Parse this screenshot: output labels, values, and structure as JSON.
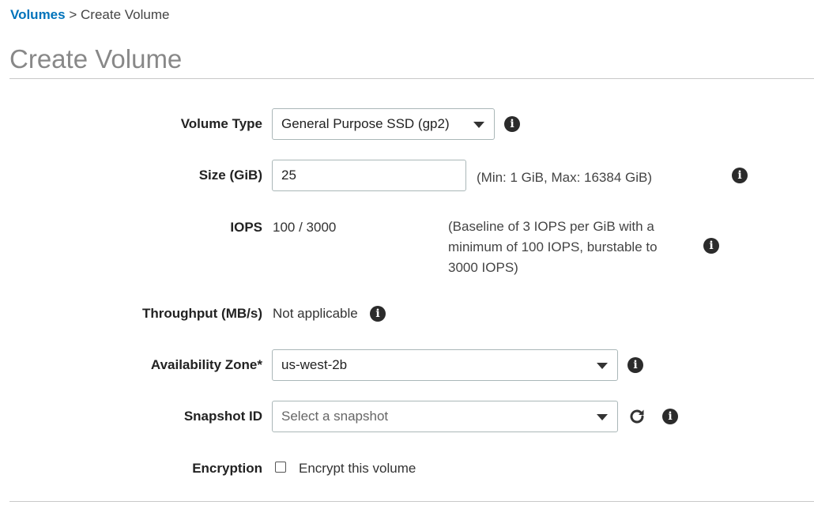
{
  "breadcrumb": {
    "link": "Volumes",
    "separator": ">",
    "current": "Create Volume"
  },
  "page_title": "Create Volume",
  "form": {
    "volume_type": {
      "label": "Volume Type",
      "value": "General Purpose SSD (gp2)"
    },
    "size": {
      "label": "Size (GiB)",
      "value": "25",
      "hint": "(Min: 1 GiB, Max: 16384 GiB)"
    },
    "iops": {
      "label": "IOPS",
      "value": "100 / 3000",
      "hint_lines": [
        "(Baseline of 3 IOPS per GiB with a",
        "minimum of 100 IOPS, burstable to",
        "3000 IOPS)"
      ]
    },
    "throughput": {
      "label": "Throughput (MB/s)",
      "value": "Not applicable"
    },
    "availability_zone": {
      "label": "Availability Zone*",
      "value": "us-west-2b"
    },
    "snapshot": {
      "label": "Snapshot ID",
      "placeholder": "Select a snapshot"
    },
    "encryption": {
      "label": "Encryption",
      "checkbox_label": "Encrypt this volume",
      "checked": false
    }
  },
  "icons": {
    "info": "info-icon",
    "refresh": "refresh-icon",
    "dropdown": "chevron-down-icon"
  },
  "colors": {
    "link": "#0073bb",
    "title": "#888888",
    "border": "#aab7b8"
  }
}
